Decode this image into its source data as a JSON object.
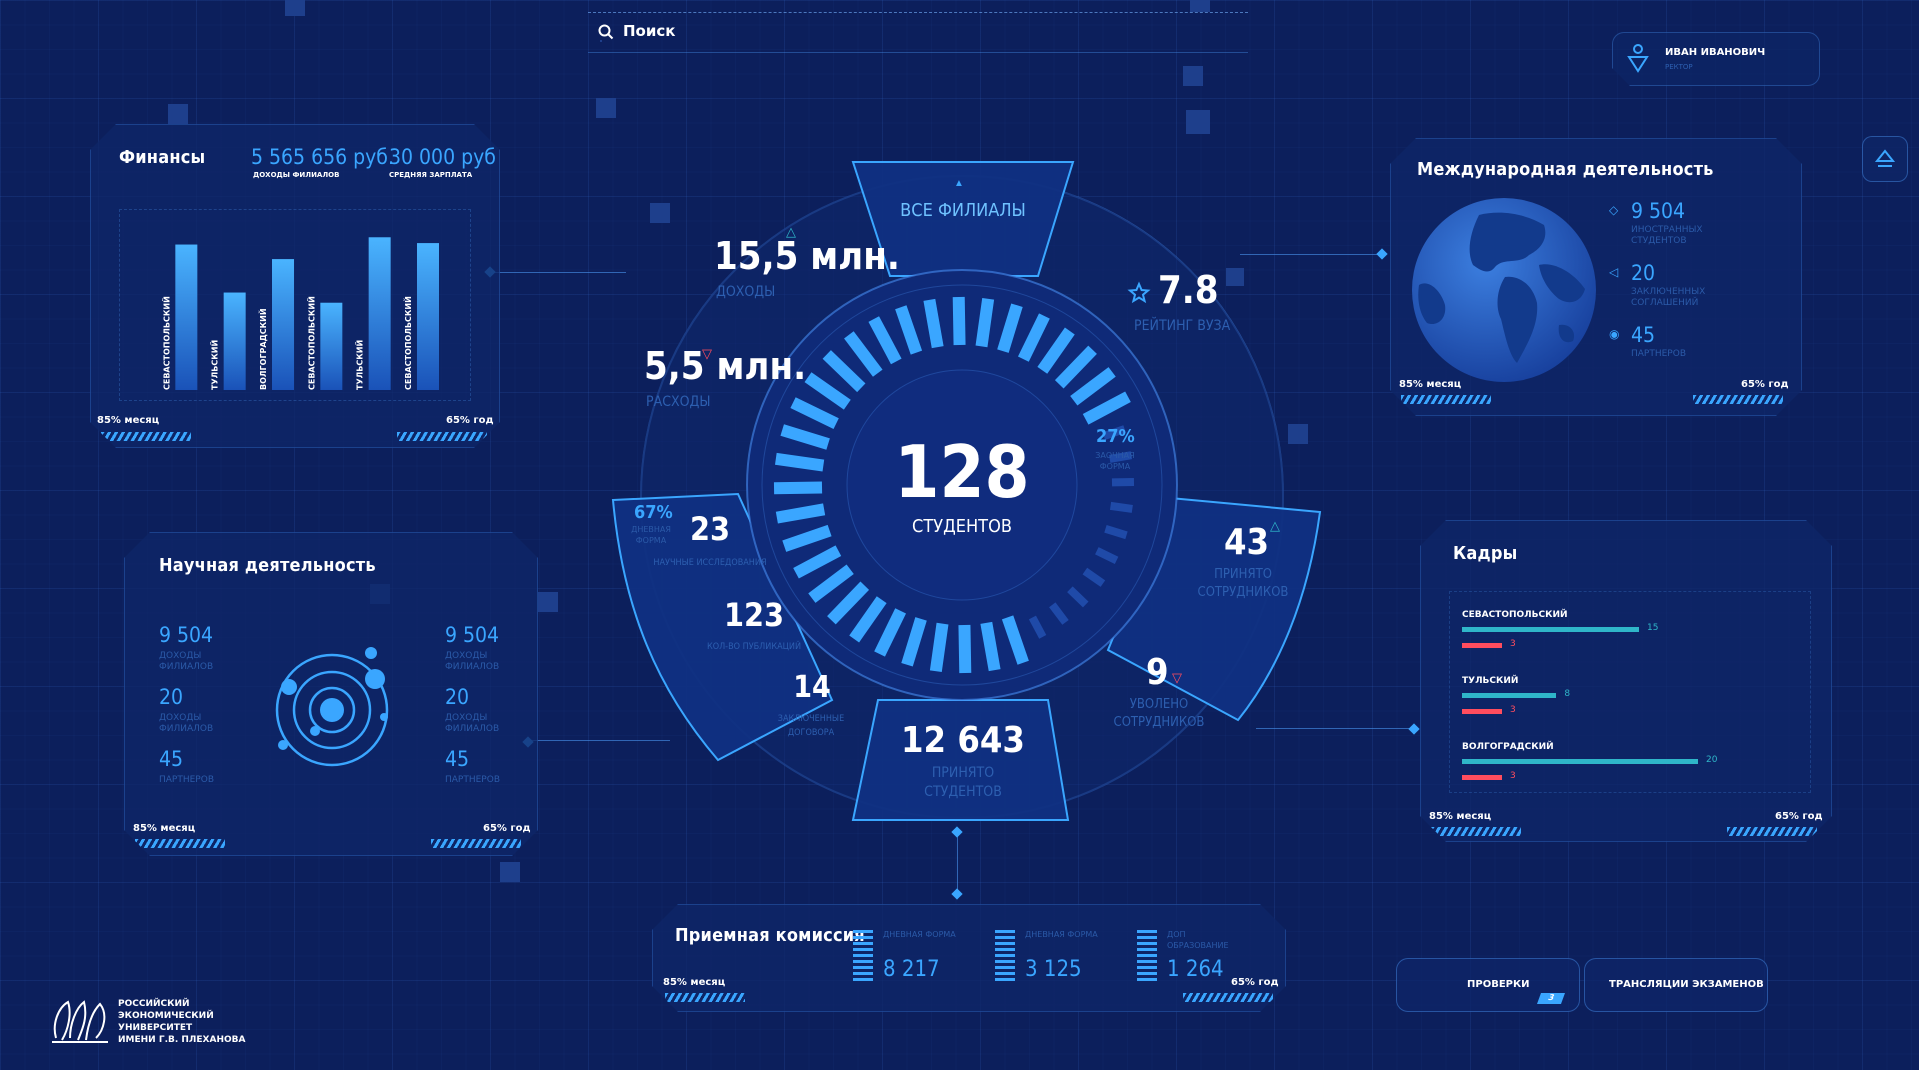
{
  "search": {
    "label": "Поиск"
  },
  "user": {
    "name": "ИВАН ИВАНОВИЧ",
    "role": "РЕКТОР"
  },
  "finance": {
    "title": "Финансы",
    "income_value": "5 565 656 руб.",
    "income_label": "ДОХОДЫ ФИЛИАЛОВ",
    "salary_value": "30 000 руб",
    "salary_label": "СРЕДНЯЯ ЗАРПЛАТА",
    "chart_data": {
      "type": "bar",
      "categories": [
        "СЕВАСТОПОЛЬСКИЙ",
        "ТУЛЬСКИЙ",
        "ВОЛГОГРАДСКИЙ",
        "СЕВАСТОПОЛЬСКИЙ",
        "ТУЛЬСКИЙ",
        "СЕВАСТОПОЛЬСКИЙ"
      ],
      "values": [
        100,
        67,
        90,
        60,
        105,
        101
      ],
      "ylim": [
        0,
        110
      ]
    },
    "foot_left": "85% месяц",
    "foot_right": "65% год"
  },
  "science": {
    "title": "Научная деятельность",
    "left": [
      {
        "value": "9 504",
        "label": "ДОХОДЫ ФИЛИАЛОВ"
      },
      {
        "value": "20",
        "label": "ДОХОДЫ ФИЛИАЛОВ"
      },
      {
        "value": "45",
        "label": "ПАРТНЕРОВ"
      }
    ],
    "right": [
      {
        "value": "9 504",
        "label": "ДОХОДЫ ФИЛИАЛОВ"
      },
      {
        "value": "20",
        "label": "ДОХОДЫ ФИЛИАЛОВ"
      },
      {
        "value": "45",
        "label": "ПАРТНЕРОВ"
      }
    ],
    "foot_left": "85% месяц",
    "foot_right": "65% год"
  },
  "center": {
    "all_branches": "ВСЕ ФИЛИАЛЫ",
    "students_value": "128",
    "students_label": "СТУДЕНТОВ",
    "income_value": "15,5 млн.",
    "income_label": "ДОХОДЫ",
    "expense_value": "5,5 млн.",
    "expense_label": "РАСХОДЫ",
    "rating_value": "7.8",
    "rating_label": "РЕЙТИНГ ВУЗА",
    "hired_staff_value": "43",
    "hired_staff_label": "ПРИНЯТО СОТРУДНИКОВ",
    "fired_staff_value": "9",
    "fired_staff_label": "УВОЛЕНО СОТРУДНИКОВ",
    "admitted_value": "12 643",
    "admitted_label": "ПРИНЯТО СТУДЕНТОВ",
    "research_value": "23",
    "research_label": "НАУЧНЫЕ ИССЛЕДОВАНИЯ",
    "publications_value": "123",
    "publications_label": "КОЛ-ВО ПУБЛИКАЦИЙ",
    "contracts_value": "14",
    "contracts_label": "ЗАКЛЮЧЕННЫЕ ДОГОВОРА",
    "day_pct": "67%",
    "day_label": "ДНЕВНАЯ ФОРМА",
    "extramural_pct": "27%",
    "extramural_label": "ЗАОЧНАЯ ФОРМА",
    "day_fraction": 0.67,
    "extramural_fraction": 0.27
  },
  "admission": {
    "title": "Приемная комиссия",
    "items": [
      {
        "label": "ДНЕВНАЯ ФОРМА",
        "value": "8 217"
      },
      {
        "label": "ДНЕВНАЯ ФОРМА",
        "value": "3 125"
      },
      {
        "label": "ДОП ОБРАЗОВАНИЕ",
        "value": "1 264"
      }
    ],
    "foot_left": "85% месяц",
    "foot_right": "65% год"
  },
  "international": {
    "title": "Международная деятельность",
    "items": [
      {
        "value": "9 504",
        "label": "ИНОСТРАННЫХ СТУДЕНТОВ"
      },
      {
        "value": "20",
        "label": "ЗАКЛЮЧЕННЫХ СОГЛАШЕНИЙ"
      },
      {
        "value": "45",
        "label": "ПАРТНЕРОВ"
      }
    ],
    "foot_left": "85% месяц",
    "foot_right": "65% год"
  },
  "staff": {
    "title": "Кадры",
    "rows": [
      {
        "name": "СЕВАСТОПОЛЬСКИЙ",
        "a": 15,
        "b": 3
      },
      {
        "name": "ТУЛЬСКИЙ",
        "a": 8,
        "b": 3
      },
      {
        "name": "ВОЛГОГРАДСКИЙ",
        "a": 20,
        "b": 3
      }
    ],
    "max": 20,
    "foot_left": "85% месяц",
    "foot_right": "65% год"
  },
  "buttons": {
    "checks": "ПРОВЕРКИ",
    "checks_badge": "3",
    "streams": "ТРАНСЛЯЦИИ ЭКЗАМЕНОВ"
  },
  "logo": {
    "lines": [
      "РОССИЙСКИЙ",
      "ЭКОНОМИЧЕСКИЙ",
      "УНИВЕРСИТЕТ",
      "ИМЕНИ Г.В. ПЛЕХАНОВА"
    ]
  },
  "colors": {
    "accent": "#3aa6ff",
    "bg": "#0c1f5c",
    "red": "#ff4d5e",
    "teal": "#2fb6c9"
  }
}
